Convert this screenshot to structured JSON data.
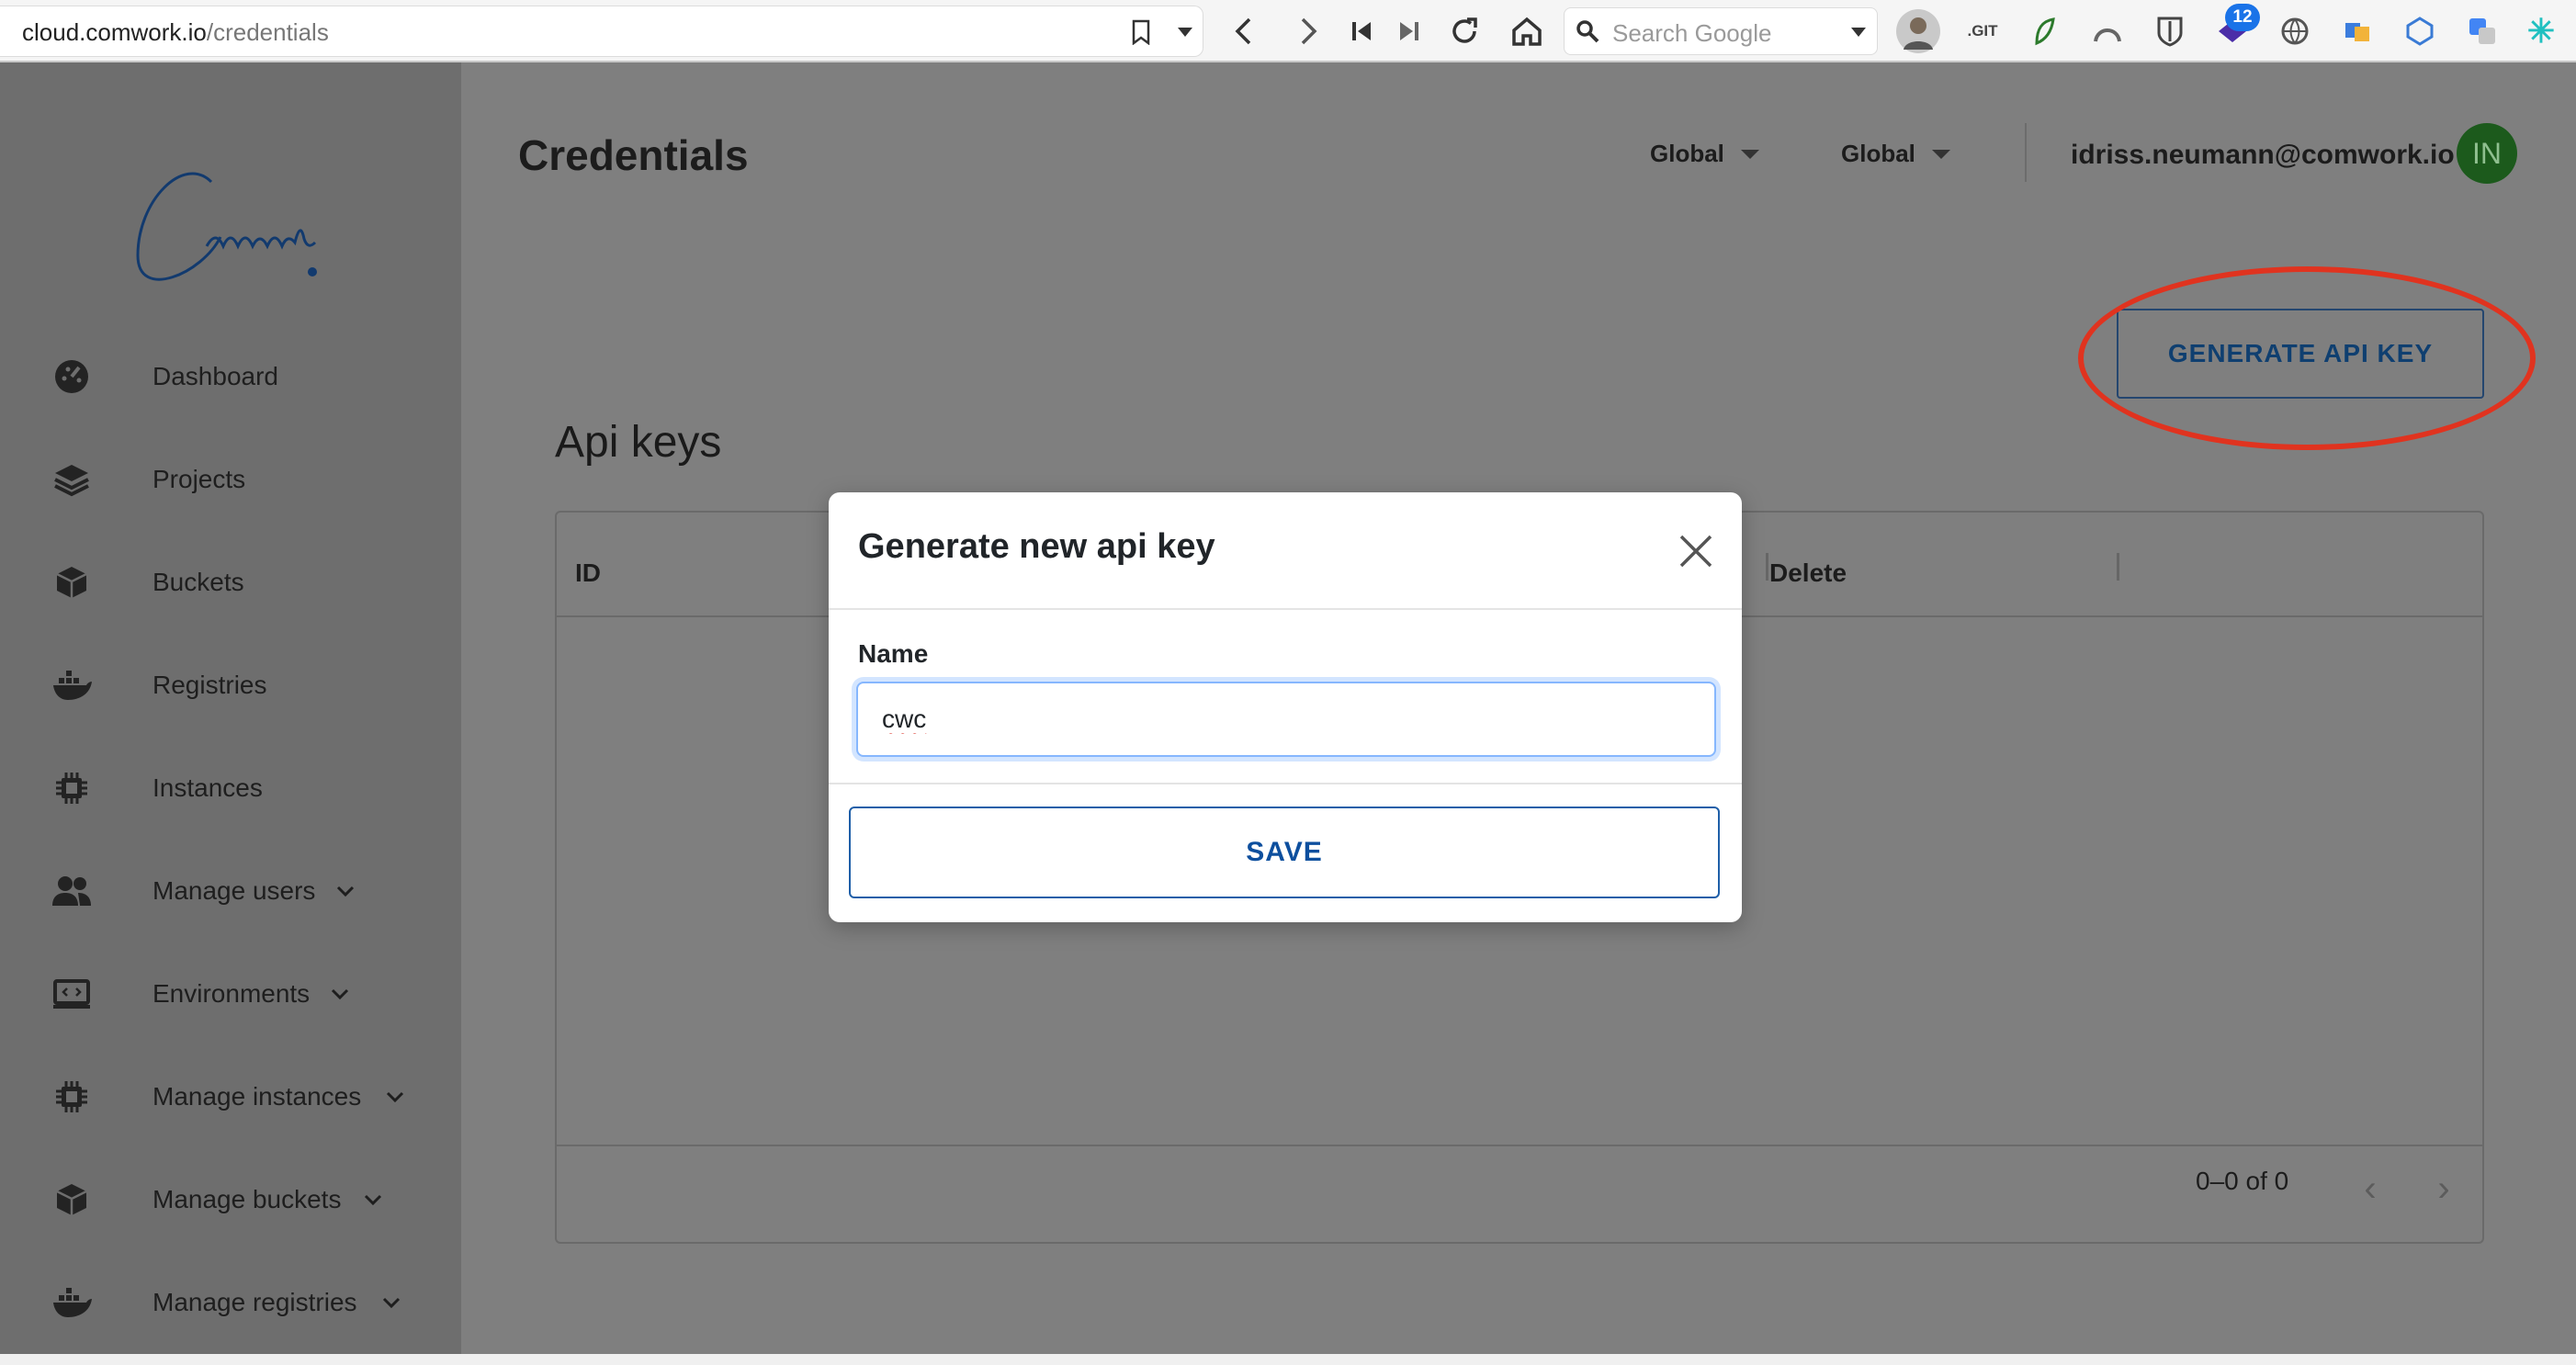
{
  "browser": {
    "url_host": "cloud.comwork.io",
    "url_path": "/credentials",
    "search_placeholder": "Search Google",
    "extension_git_label": ".GIT",
    "notification_count": "12",
    "icons": [
      "bookmark-icon",
      "back-icon",
      "forward-icon",
      "reload-icon",
      "home-icon",
      "search-icon"
    ]
  },
  "app": {
    "brand_text": "Comwork",
    "page_title": "Credentials",
    "selectors": [
      "Global",
      "Global"
    ],
    "user_email": "idriss.neumann@comwork.io",
    "user_initials": "IN",
    "avatar_color": "#1c5a1c",
    "generate_button": "GENERATE API KEY",
    "highlight_color": "#e0331f"
  },
  "sidebar": {
    "items": [
      {
        "label": "Dashboard",
        "icon": "dashboard-icon"
      },
      {
        "label": "Projects",
        "icon": "layers-icon"
      },
      {
        "label": "Buckets",
        "icon": "cube-icon"
      },
      {
        "label": "Registries",
        "icon": "docker-icon"
      },
      {
        "label": "Instances",
        "icon": "chip-icon"
      },
      {
        "label": "Manage users",
        "icon": "users-icon"
      },
      {
        "label": "Environments",
        "icon": "code-screen-icon"
      },
      {
        "label": "Manage instances",
        "icon": "chip-icon"
      },
      {
        "label": "Manage buckets",
        "icon": "cube-icon"
      },
      {
        "label": "Manage registries",
        "icon": "docker-icon"
      }
    ]
  },
  "table": {
    "section_title": "Api keys",
    "columns": [
      "ID",
      "Delete"
    ],
    "pagination": "0–0 of 0"
  },
  "modal": {
    "title": "Generate new api key",
    "field_label": "Name",
    "field_value": "cwc",
    "save_label": "SAVE"
  }
}
